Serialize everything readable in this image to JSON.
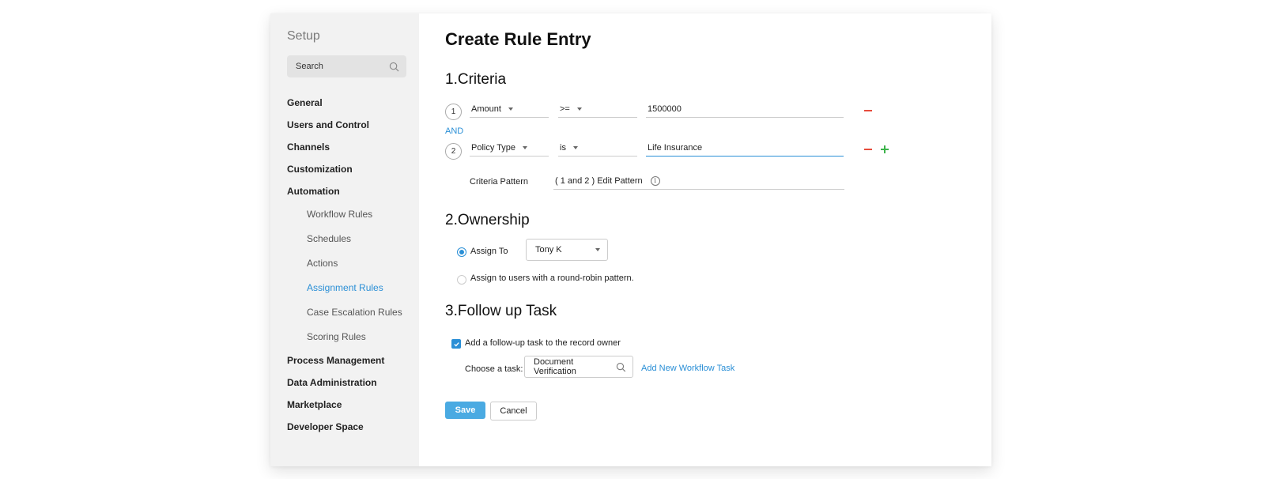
{
  "sidebar": {
    "title": "Setup",
    "search_placeholder": "Search",
    "items": [
      {
        "label": "General",
        "type": "group"
      },
      {
        "label": "Users and Control",
        "type": "group"
      },
      {
        "label": "Channels",
        "type": "group"
      },
      {
        "label": "Customization",
        "type": "group"
      },
      {
        "label": "Automation",
        "type": "group"
      },
      {
        "label": "Workflow Rules",
        "type": "sub"
      },
      {
        "label": "Schedules",
        "type": "sub"
      },
      {
        "label": "Actions",
        "type": "sub"
      },
      {
        "label": "Assignment Rules",
        "type": "sub",
        "active": true
      },
      {
        "label": "Case Escalation Rules",
        "type": "sub"
      },
      {
        "label": "Scoring Rules",
        "type": "sub"
      },
      {
        "label": "Process Management",
        "type": "group"
      },
      {
        "label": "Data Administration",
        "type": "group"
      },
      {
        "label": "Marketplace",
        "type": "group"
      },
      {
        "label": "Developer Space",
        "type": "group"
      }
    ]
  },
  "main": {
    "title": "Create Rule Entry",
    "criteria": {
      "heading": "1.Criteria",
      "rows": [
        {
          "num": "1",
          "field": "Amount",
          "operator": ">=",
          "value": "1500000"
        },
        {
          "num": "2",
          "field": "Policy Type",
          "operator": "is",
          "value": "Life Insurance"
        }
      ],
      "joiner": "AND",
      "pattern_label": "Criteria Pattern",
      "pattern_value": "( 1 and 2 ) Edit Pattern"
    },
    "ownership": {
      "heading": "2.Ownership",
      "assign_to_label": "Assign To",
      "assign_to_value": "Tony K",
      "round_robin_label": "Assign to users with a round-robin pattern."
    },
    "followup": {
      "heading": "3.Follow up Task",
      "checkbox_label": "Add a follow-up task to the record owner",
      "choose_label": "Choose a task:",
      "task_value": "Document Verification",
      "add_link": "Add New Workflow Task"
    },
    "buttons": {
      "save": "Save",
      "cancel": "Cancel"
    }
  },
  "colors": {
    "accent": "#2a8fd6",
    "save_button": "#4aaae2",
    "remove": "#e74c3c",
    "add": "#3cb34a"
  }
}
